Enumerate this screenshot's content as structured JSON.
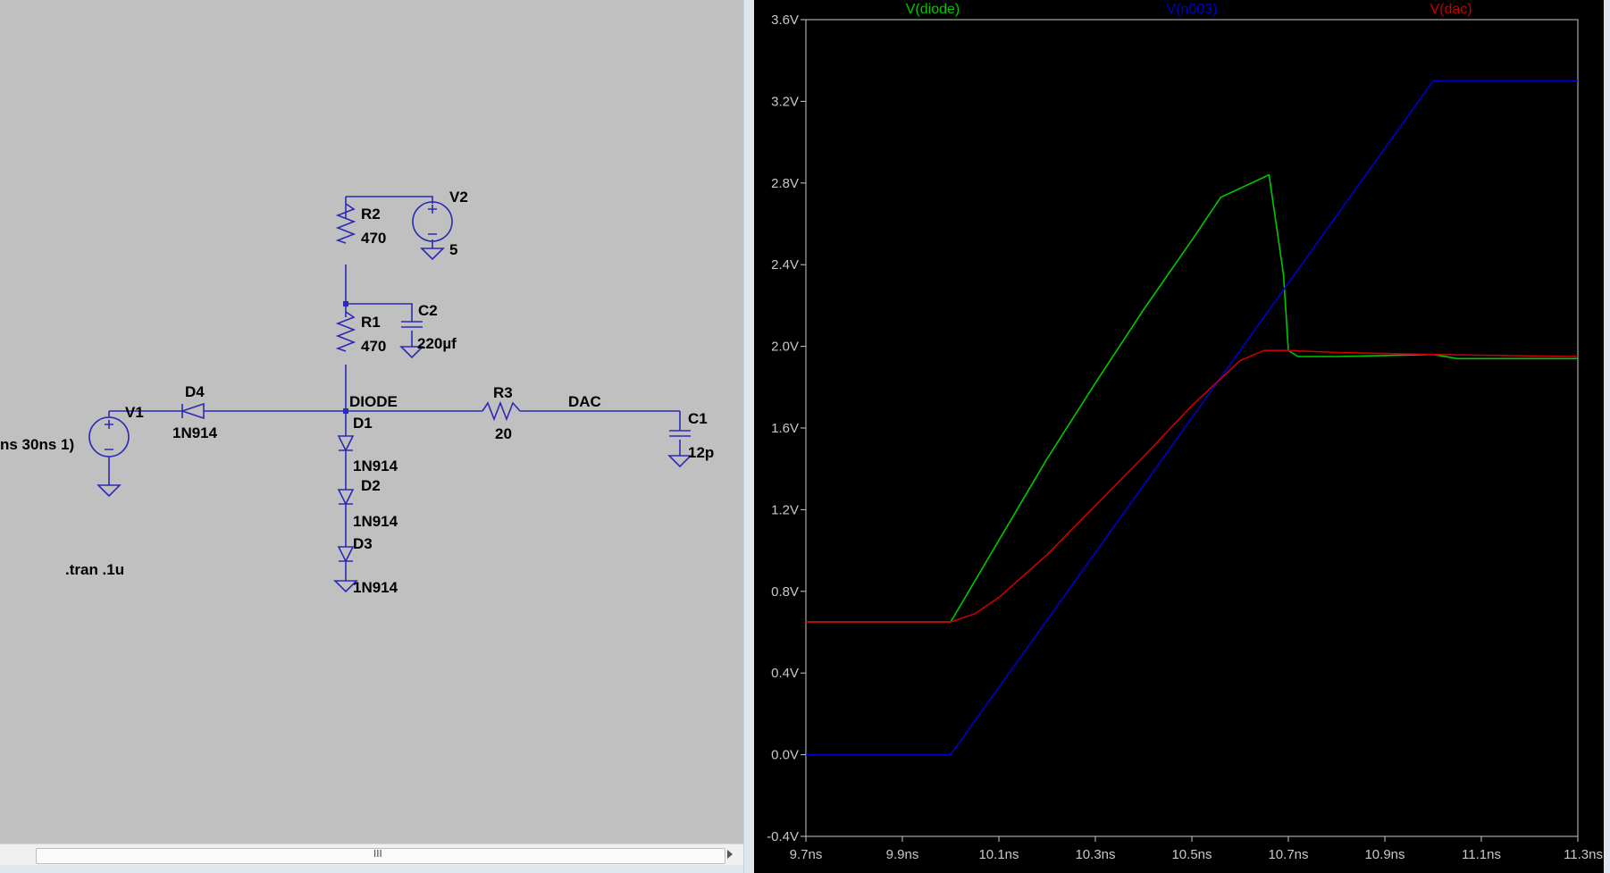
{
  "schematic": {
    "components": {
      "V1": {
        "name": "V1",
        "source_text": "ns 30ns 1)"
      },
      "V2": {
        "name": "V2",
        "value": "5"
      },
      "D4": {
        "name": "D4",
        "value": "1N914"
      },
      "R1": {
        "name": "R1",
        "value": "470"
      },
      "R2": {
        "name": "R2",
        "value": "470"
      },
      "R3": {
        "name": "R3",
        "value": "20"
      },
      "C1": {
        "name": "C1",
        "value": "12p"
      },
      "C2": {
        "name": "C2",
        "value": "220µf"
      },
      "D1": {
        "name": "D1",
        "value": "1N914"
      },
      "D2": {
        "name": "D2",
        "value": "1N914"
      },
      "D3": {
        "name": "D3",
        "value": "1N914"
      }
    },
    "nets": {
      "diode": "DIODE",
      "dac": "DAC"
    },
    "directive": ".tran .1u",
    "scrollbar_grip": "III"
  },
  "waveform": {
    "colors": {
      "background": "#000000",
      "axis": "#c8c8c8",
      "diode": "#00c800",
      "n003": "#0000c8",
      "dac": "#c80000"
    },
    "legend": [
      "V(diode)",
      "V(n003)",
      "V(dac)"
    ],
    "y_ticks": [
      "3.6V",
      "3.2V",
      "2.8V",
      "2.4V",
      "2.0V",
      "1.6V",
      "1.2V",
      "0.8V",
      "0.4V",
      "0.0V",
      "-0.4V"
    ],
    "x_ticks": [
      "9.7ns",
      "9.9ns",
      "10.1ns",
      "10.3ns",
      "10.5ns",
      "10.7ns",
      "10.9ns",
      "11.1ns",
      "11.3ns"
    ]
  },
  "chart_data": {
    "type": "line",
    "xlabel": "",
    "ylabel": "",
    "xlim": [
      9.7,
      11.3
    ],
    "ylim": [
      -0.4,
      3.6
    ],
    "x_unit": "ns",
    "y_unit": "V",
    "grid": false,
    "legend": "top",
    "series": [
      {
        "name": "V(diode)",
        "color": "#00c800",
        "x": [
          9.7,
          10.0,
          10.1,
          10.2,
          10.3,
          10.4,
          10.5,
          10.56,
          10.66,
          10.69,
          10.7,
          10.72,
          10.8,
          11.0,
          11.05,
          11.3
        ],
        "y": [
          0.65,
          0.65,
          1.05,
          1.45,
          1.82,
          2.18,
          2.52,
          2.73,
          2.84,
          2.35,
          1.98,
          1.95,
          1.95,
          1.96,
          1.94,
          1.94
        ]
      },
      {
        "name": "V(n003)",
        "color": "#0000c8",
        "x": [
          9.7,
          10.0,
          11.0,
          11.3
        ],
        "y": [
          0.0,
          0.0,
          3.3,
          3.3
        ]
      },
      {
        "name": "V(dac)",
        "color": "#c80000",
        "x": [
          9.7,
          10.0,
          10.05,
          10.1,
          10.2,
          10.3,
          10.4,
          10.5,
          10.6,
          10.65,
          10.7,
          10.8,
          11.0,
          11.3
        ],
        "y": [
          0.65,
          0.65,
          0.69,
          0.77,
          0.98,
          1.22,
          1.46,
          1.71,
          1.93,
          1.98,
          1.98,
          1.97,
          1.96,
          1.95
        ]
      }
    ]
  }
}
